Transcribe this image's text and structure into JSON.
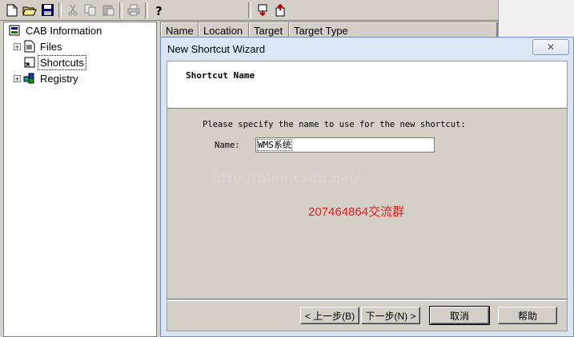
{
  "toolbar": {
    "icons": [
      "new-file-icon",
      "open-folder-icon",
      "save-icon",
      "cut-icon",
      "copy-icon",
      "paste-icon",
      "print-icon",
      "help-icon",
      "generate-icon",
      "build-icon"
    ]
  },
  "tree": {
    "root": "CAB Information",
    "items": [
      {
        "label": "Files",
        "expander": "+"
      },
      {
        "label": "Shortcuts",
        "expander": ""
      },
      {
        "label": "Registry",
        "expander": "+"
      }
    ]
  },
  "list": {
    "columns": [
      "Name",
      "Location",
      "Target",
      "Target Type"
    ]
  },
  "dialog": {
    "title": "New Shortcut Wizard",
    "close_label": "✕",
    "banner_title": "Shortcut Name",
    "prompt": "Please specify the name to use for the new shortcut:",
    "name_label": "Name:",
    "name_value": "WMS系统",
    "watermark": "http://blog.csdn.net/",
    "group_text": "207464864交流群",
    "buttons": {
      "back": "< 上一步(B)",
      "next": "下一步(N) >",
      "cancel": "取消",
      "help": "帮助"
    }
  }
}
